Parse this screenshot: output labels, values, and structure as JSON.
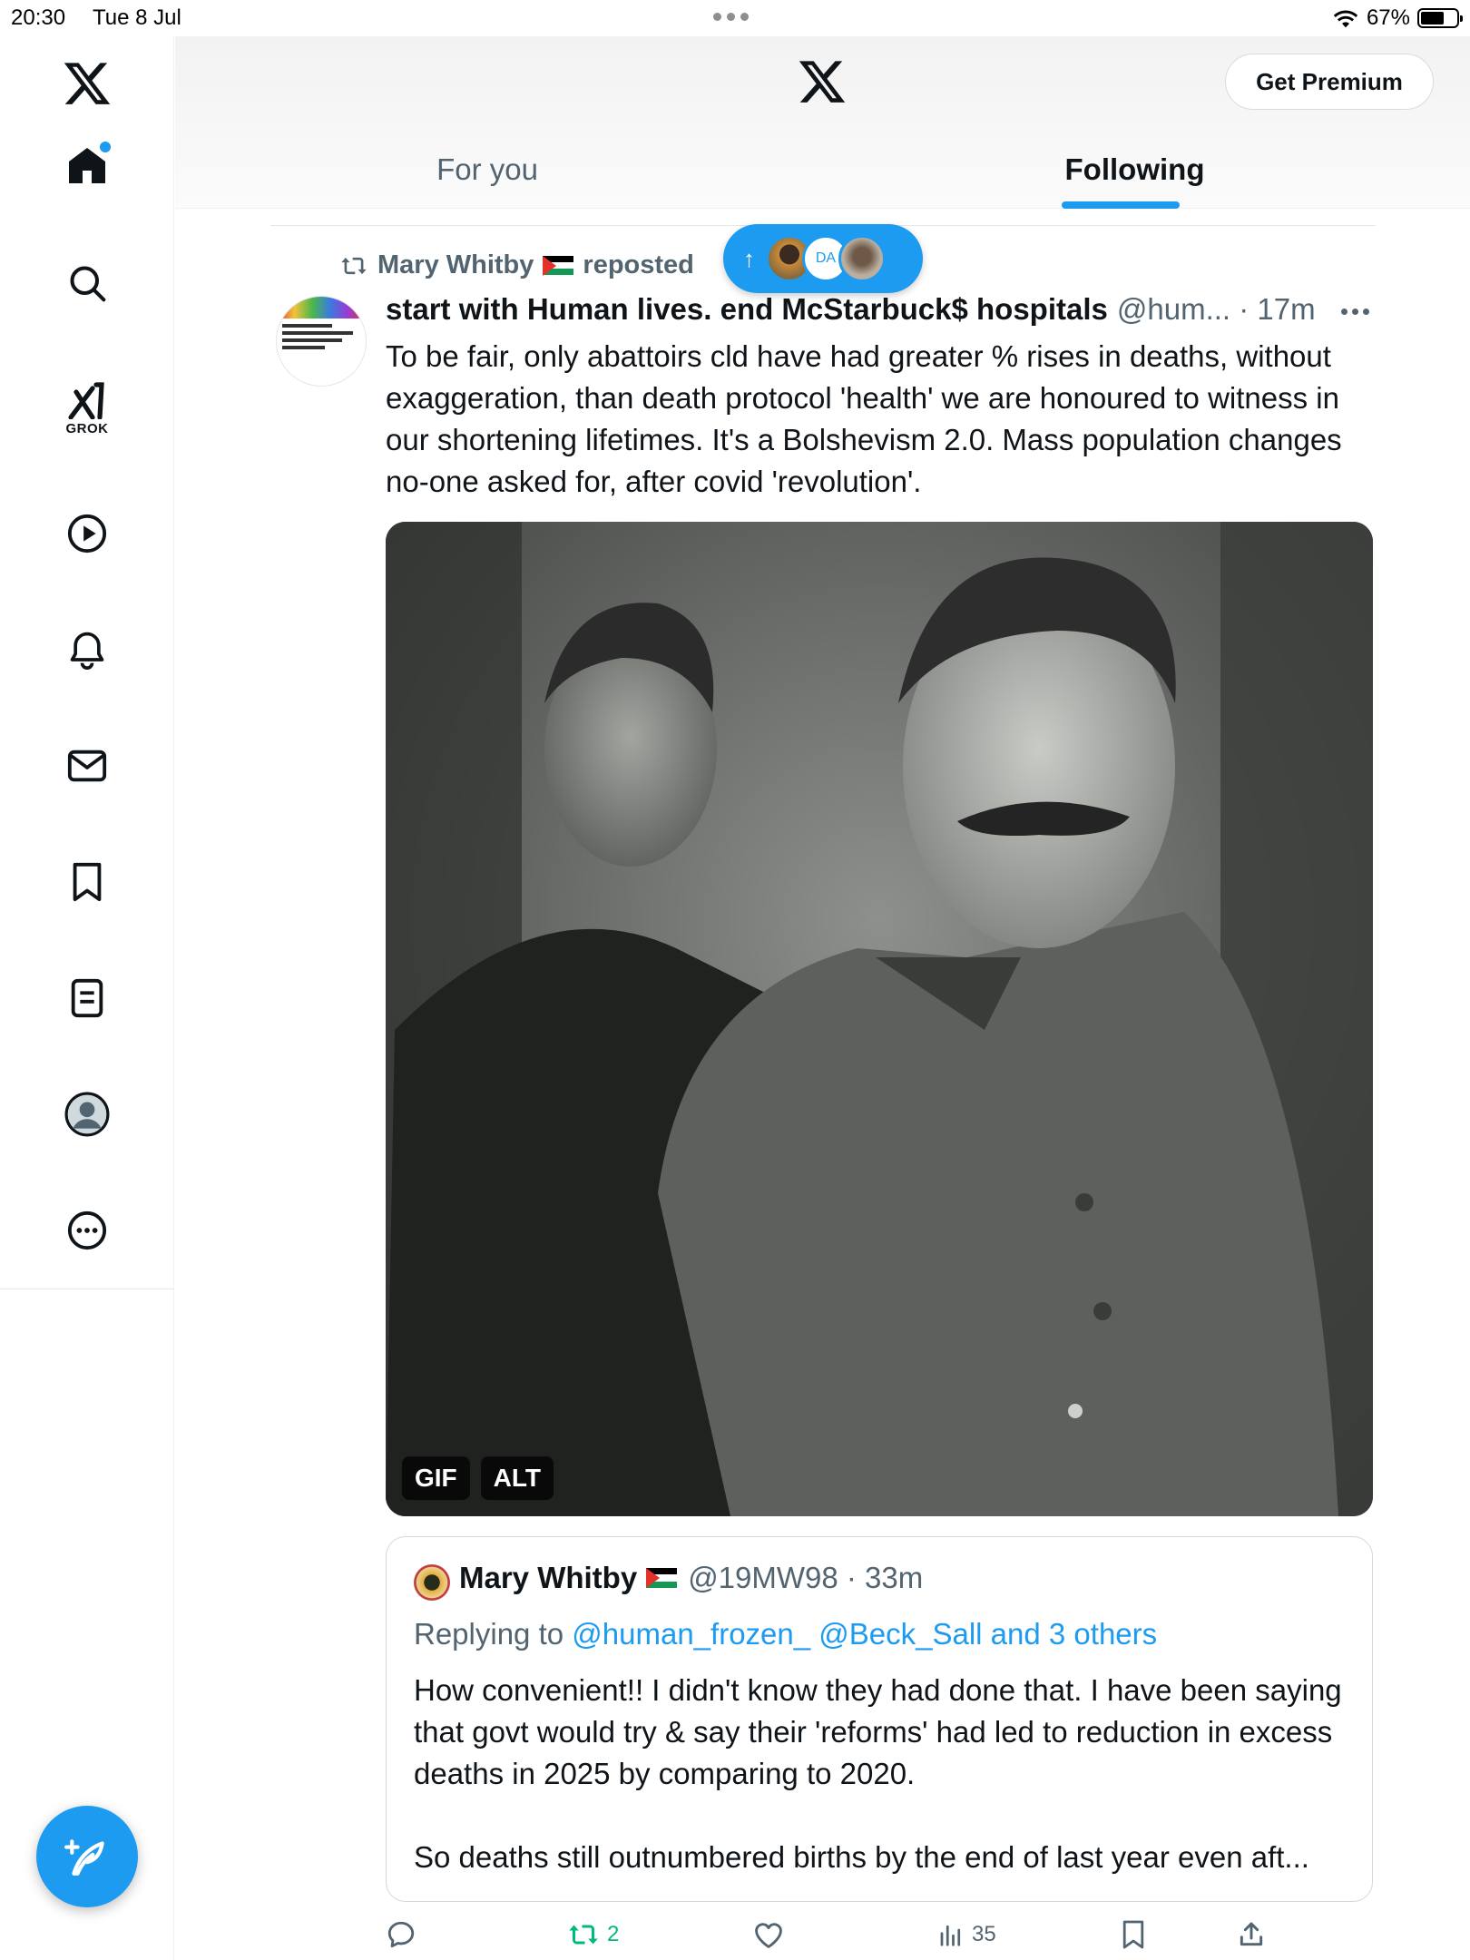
{
  "status_bar": {
    "time": "20:30",
    "date": "Tue 8 Jul",
    "battery": "67%",
    "battery_level": 0.67
  },
  "sidebar": {
    "items": [
      {
        "name": "home",
        "label": "Home"
      },
      {
        "name": "explore",
        "label": "Explore"
      },
      {
        "name": "grok",
        "label": "GROK"
      },
      {
        "name": "videos",
        "label": "Videos"
      },
      {
        "name": "notifications",
        "label": "Notifications"
      },
      {
        "name": "messages",
        "label": "Messages"
      },
      {
        "name": "bookmarks",
        "label": "Bookmarks"
      },
      {
        "name": "lists",
        "label": "Lists"
      },
      {
        "name": "profile",
        "label": "Profile"
      },
      {
        "name": "more",
        "label": "More"
      }
    ]
  },
  "header": {
    "premium_label": "Get Premium",
    "tabs": [
      {
        "label": "For you",
        "active": false
      },
      {
        "label": "Following",
        "active": true
      }
    ]
  },
  "new_posts_pill": {
    "avatar_text": "DA"
  },
  "post": {
    "repost_by": "Mary Whitby",
    "repost_suffix": "reposted",
    "author_name": "start with Human lives. end McStarbuck$ hospitals",
    "author_meta": "@hum... · 17m",
    "text": "To be fair, only abattoirs cld have had greater % rises in deaths, without exaggeration, than death protocol 'health' we are honoured to witness in our shortening lifetimes. It's a Bolshevism 2.0. Mass population changes no-one asked for, after covid 'revolution'.",
    "media_badges": [
      "GIF",
      "ALT"
    ],
    "quote": {
      "author_name": "Mary Whitby",
      "author_meta": "@19MW98 · 33m",
      "replying_prefix": "Replying to",
      "replying_to": "@human_frozen_ @Beck_Sall and 3 others",
      "text_p1": "How convenient!! I didn't know they had done that. I have been saying that govt would try & say their 'reforms' had led to reduction in excess deaths in 2025 by comparing to 2020.",
      "text_p2": "So deaths still outnumbered births by the end of last year even aft..."
    },
    "actions": {
      "replies": "",
      "reposts": "2",
      "likes": "",
      "views": "35"
    }
  },
  "colors": {
    "accent": "#1d9bf0",
    "repost_green": "#00ba7c",
    "muted": "#536471"
  }
}
